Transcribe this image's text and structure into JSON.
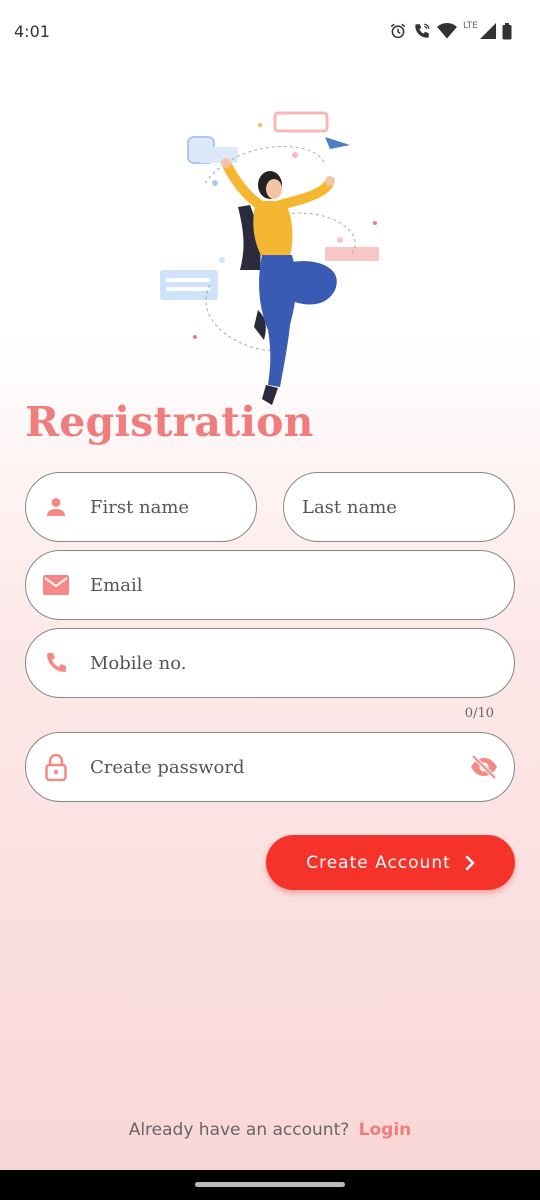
{
  "status_bar": {
    "time": "4:01",
    "network": "LTE",
    "icons": [
      "alarm-icon",
      "wifi-calling-icon",
      "wifi-icon",
      "signal-icon",
      "battery-icon"
    ]
  },
  "illustration": {
    "icon": "woman-juggling-illustration"
  },
  "page": {
    "title": "Registration"
  },
  "form": {
    "first_name": {
      "placeholder": "First name",
      "icon": "person-icon"
    },
    "last_name": {
      "placeholder": "Last name"
    },
    "email": {
      "placeholder": "Email",
      "icon": "mail-icon"
    },
    "mobile": {
      "placeholder": "Mobile no.",
      "icon": "phone-icon",
      "counter": "0/10"
    },
    "password": {
      "placeholder": "Create password",
      "icon": "lock-icon",
      "toggle_icon": "eye-off-icon"
    }
  },
  "actions": {
    "create_account": "Create Account"
  },
  "footer": {
    "prompt": "Already have an account?",
    "login": "Login"
  },
  "colors": {
    "accent": "#ef7d7d",
    "button": "#f5332a",
    "field_border": "#888888"
  }
}
